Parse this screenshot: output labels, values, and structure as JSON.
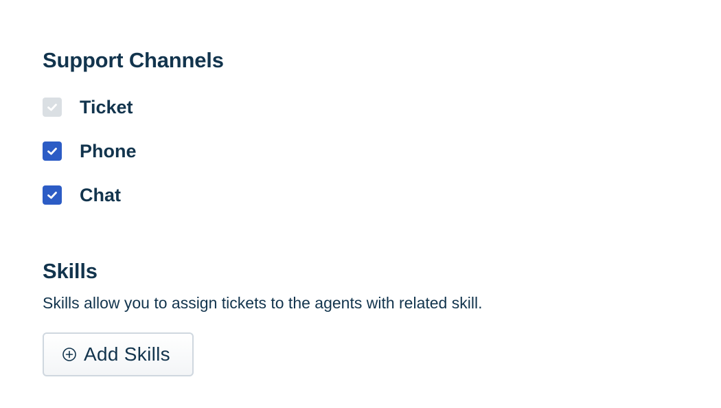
{
  "support_channels": {
    "title": "Support Channels",
    "items": [
      {
        "label": "Ticket",
        "checked": true,
        "disabled": true
      },
      {
        "label": "Phone",
        "checked": true,
        "disabled": false
      },
      {
        "label": "Chat",
        "checked": true,
        "disabled": false
      }
    ]
  },
  "skills": {
    "title": "Skills",
    "description": "Skills allow you to assign tickets to the agents with related skill.",
    "add_button_label": "Add Skills",
    "add_button_icon": "plus-circle-icon"
  },
  "colors": {
    "text": "#12344d",
    "checkbox_checked": "#2c5cc5",
    "checkbox_disabled": "#dadfe3",
    "button_border": "#cfd7df"
  }
}
